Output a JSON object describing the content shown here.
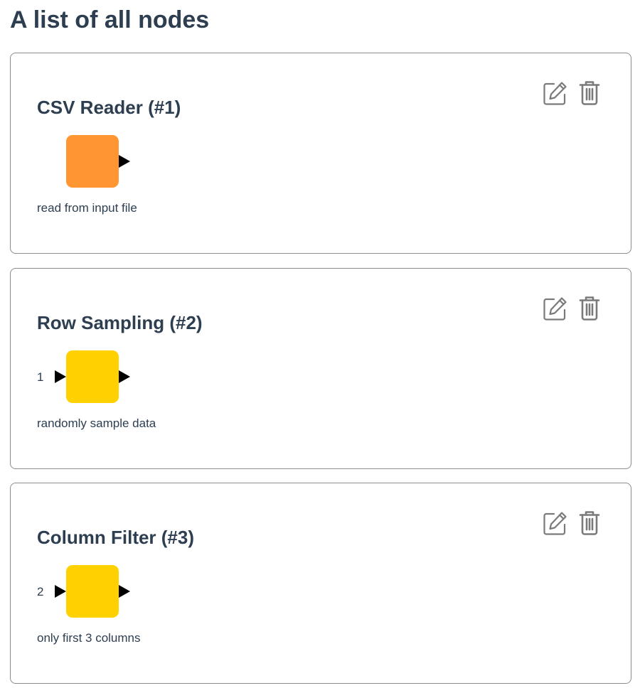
{
  "page": {
    "title": "A list of all nodes"
  },
  "nodes": [
    {
      "title": "CSV Reader (#1)",
      "description": "read from input file",
      "input_port_label": "",
      "has_input": false,
      "color": "#FF9632",
      "edit_icon": "edit-icon",
      "delete_icon": "trash-icon"
    },
    {
      "title": "Row Sampling (#2)",
      "description": "randomly sample data",
      "input_port_label": "1",
      "has_input": true,
      "color": "#FFD100",
      "edit_icon": "edit-icon",
      "delete_icon": "trash-icon"
    },
    {
      "title": "Column Filter (#3)",
      "description": "only first 3 columns",
      "input_port_label": "2",
      "has_input": true,
      "color": "#FFD100",
      "edit_icon": "edit-icon",
      "delete_icon": "trash-icon"
    }
  ],
  "colors": {
    "text": "#2c3e50",
    "icon": "#7a7a7a",
    "border": "#8c8c8c",
    "port": "#000000"
  }
}
